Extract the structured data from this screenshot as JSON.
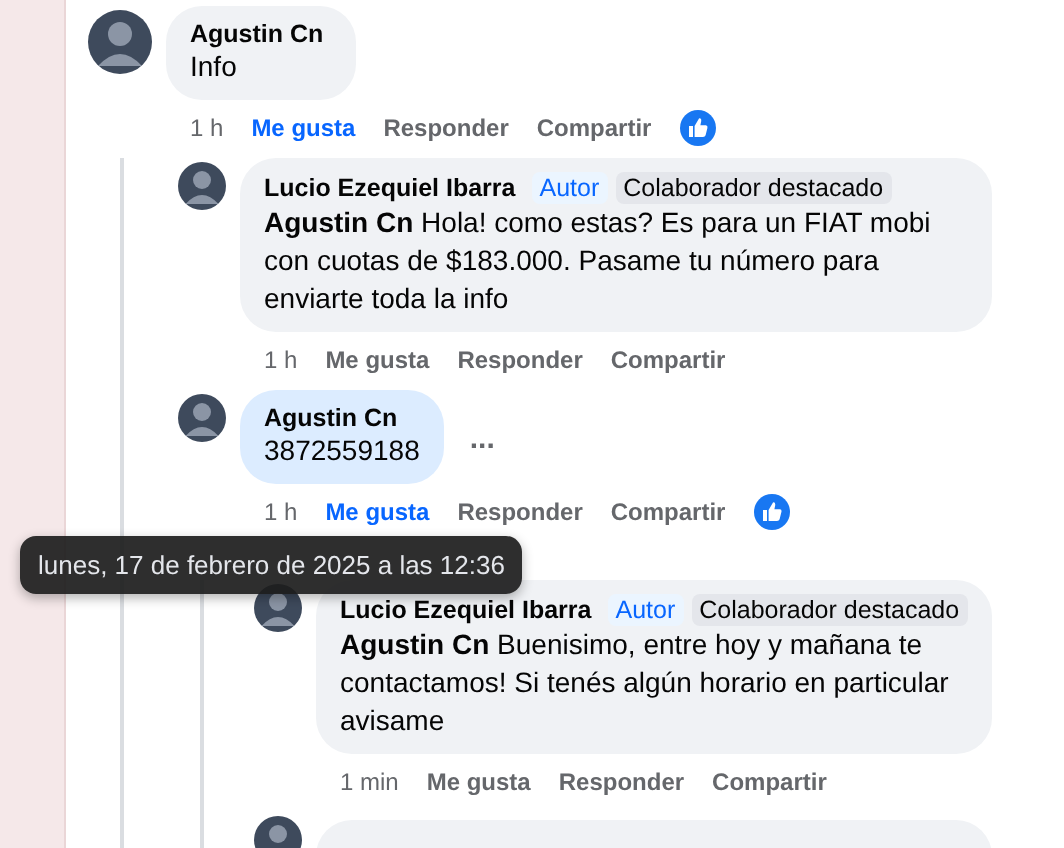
{
  "comments": [
    {
      "author": "Agustin Cn",
      "text": "Info",
      "time": "1 h",
      "actions": [
        "Me gusta",
        "Responder",
        "Compartir"
      ],
      "liked": true,
      "reaction": true,
      "highlighted": false,
      "children": [
        {
          "author": "Lucio Ezequiel Ibarra",
          "badges": [
            {
              "label": "Autor",
              "kind": "author"
            },
            {
              "label": "Colaborador destacado",
              "kind": "fan"
            }
          ],
          "text": "**Agustin Cn** Hola! como estas? Es para un FIAT mobi con cuotas de $183.000. Pasame tu número para enviarte toda la info",
          "time": "1 h",
          "actions": [
            "Me gusta",
            "Responder",
            "Compartir"
          ],
          "liked": false,
          "reaction": false,
          "highlighted": false
        },
        {
          "author": "Agustin Cn",
          "text": "3872559188",
          "time": "1 h",
          "actions": [
            "Me gusta",
            "Responder",
            "Compartir"
          ],
          "liked": true,
          "reaction": true,
          "highlighted": true,
          "more": "...",
          "tooltip": "lunes, 17 de febrero de 2025 a las 12:36",
          "children": [
            {
              "author": "Lucio Ezequiel Ibarra",
              "badges": [
                {
                  "label": "Autor",
                  "kind": "author"
                },
                {
                  "label": "Colaborador destacado",
                  "kind": "fan"
                }
              ],
              "text": "**Agustin Cn** Buenisimo, entre hoy y mañana te contactamos! Si tenés algún horario en particular avisame",
              "time": "1 min",
              "actions": [
                "Me gusta",
                "Responder",
                "Compartir"
              ],
              "liked": false,
              "reaction": false,
              "highlighted": false
            },
            {
              "kind": "partial"
            }
          ]
        }
      ]
    }
  ]
}
